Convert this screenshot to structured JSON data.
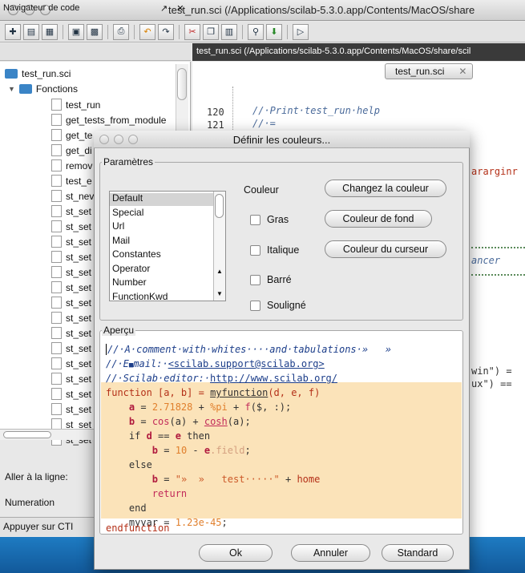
{
  "window": {
    "title": "test_run.sci (/Applications/scilab-5.3.0.app/Contents/MacOS/share"
  },
  "navigator": {
    "title": "Navigateur de code",
    "controls": "↗ ✕",
    "root": "test_run.sci",
    "folder": "Fonctions",
    "items": [
      "test_run",
      "get_tests_from_module",
      "get_te",
      "get_di",
      "remov",
      "test_e",
      "st_nev",
      "st_set",
      "st_set",
      "st_set",
      "st_set",
      "st_set",
      "st_set",
      "st_set",
      "st_set",
      "st_set",
      "st_set",
      "st_set",
      "st_set",
      "st_set",
      "st_set",
      "st_set",
      "st_set"
    ],
    "goto_label": "Aller à la ligne:",
    "numeration_label": "Numeration"
  },
  "status": "Appuyer sur CTI",
  "editor": {
    "tab_path": "test_run.sci (/Applications/scilab-5.3.0.app/Contents/MacOS/share/scil",
    "file_tab": "test_run.sci",
    "line_numbers": [
      "120",
      "121"
    ],
    "line120": "//·Print·test_run·help",
    "line121": "//·=",
    "frag1": "ararginr",
    "frag2": "ancer",
    "frag3": "win\") =",
    "frag4": "ux\") =="
  },
  "dialog": {
    "title": "Définir les couleurs...",
    "params_legend": "Paramètres",
    "couleur_label": "Couleur",
    "styles": [
      "Default",
      "Special",
      "Url",
      "Mail",
      "Constantes",
      "Operator",
      "Number",
      "FunctionKwd"
    ],
    "selected_style": "Default",
    "btn_change_color": "Changez la couleur",
    "btn_bg_color": "Couleur de fond",
    "btn_cursor_color": "Couleur du curseur",
    "chk_gras": "Gras",
    "chk_italique": "Italique",
    "chk_barre": "Barré",
    "chk_souligne": "Souligné",
    "preview_legend": "Aperçu",
    "ok": "Ok",
    "cancel": "Annuler",
    "standard": "Standard"
  },
  "preview": {
    "l1": "//·A·comment·with·whites····and·tabulations·»   »",
    "l2a": "//·E",
    "l2b": "mail:·",
    "l2c": "<scilab.support@scilab.org>",
    "l3a": "//·Scilab·editor:·",
    "l3b": "http://www.scilab.org/",
    "l4a": "function ",
    "l4b": "[a, b] = ",
    "l4c": "myfunction",
    "l4d": "(d, e, f)",
    "l5a": "    a",
    "l5b": " = ",
    "l5c": "2.71828",
    "l5d": " + ",
    "l5e": "%pi",
    "l5f": " + ",
    "l5g": "f",
    "l5h": "($, :);",
    "l6a": "    b",
    "l6b": " = ",
    "l6c": "cos",
    "l6d": "(a) + ",
    "l6e": "cosh",
    "l6f": "(a);",
    "l7a": "    if ",
    "l7b": "d",
    "l7c": " == ",
    "l7d": "e",
    "l7e": " then",
    "l8a": "        b",
    "l8b": " = ",
    "l8c": "10",
    "l8d": " - ",
    "l8e": "e",
    "l8f": ".field",
    "l8g": ";",
    "l9": "    else",
    "l10a": "        b",
    "l10b": " = ",
    "l10c": "\"»  »   test·····\"",
    "l10d": " + ",
    "l10e": "home",
    "l11": "        return",
    "l12": "    end",
    "l13a": "    myvar",
    "l13b": " = ",
    "l13c": "1.23e-45",
    "l13d": ";",
    "l14": "endfunction"
  }
}
